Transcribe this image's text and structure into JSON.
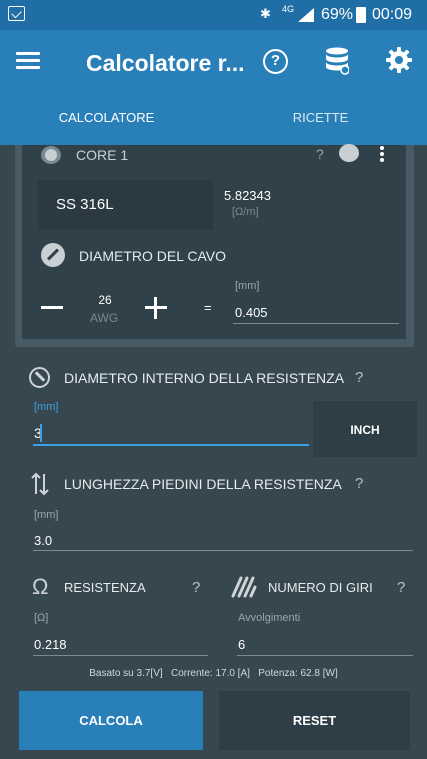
{
  "status_bar": {
    "network": "4G",
    "battery": "69%",
    "time": "00:09"
  },
  "app_bar": {
    "title": "Calcolatore r..."
  },
  "tabs": [
    {
      "label": "CALCOLATORE",
      "active": true
    },
    {
      "label": "RICETTE",
      "active": false
    }
  ],
  "core": {
    "label": "CORE 1",
    "help": "?",
    "material": "SS 316L",
    "resistivity_value": "5.82343",
    "resistivity_unit": "[Ω/m]",
    "wire_diameter_label": "DIAMETRO DEL CAVO",
    "awg_value": "26",
    "awg_unit": "AWG",
    "equals": "=",
    "diameter_unit": "[mm]",
    "diameter_value": "0.405"
  },
  "inner_diameter": {
    "label": "DIAMETRO INTERNO DELLA RESISTENZA",
    "help": "?",
    "unit": "[mm]",
    "value": "3",
    "inch_button": "INCH"
  },
  "leg_length": {
    "label": "LUNGHEZZA PIEDINI DELLA RESISTENZA",
    "help": "?",
    "unit": "[mm]",
    "value": "3.0"
  },
  "resistance": {
    "label": "RESISTENZA",
    "help": "?",
    "unit": "[Ω]",
    "value": "0.218"
  },
  "wraps": {
    "label": "NUMERO DI GIRI",
    "help": "?",
    "unit": "Avvolgimenti",
    "value": "6"
  },
  "footer": {
    "summary": "Basato su 3.7[V]   Corrente: 17.0 [A]   Potenza: 62.8 [W]"
  },
  "buttons": {
    "calculate": "CALCOLA",
    "reset": "RESET"
  },
  "colors": {
    "primary": "#2980b9",
    "background": "#37474f",
    "accent": "#3ea0e0"
  },
  "icons": {
    "status_left": "app-notification-icon",
    "menu": "hamburger-menu-icon",
    "help": "help-circle-icon",
    "database": "database-icon",
    "settings": "gear-icon"
  }
}
